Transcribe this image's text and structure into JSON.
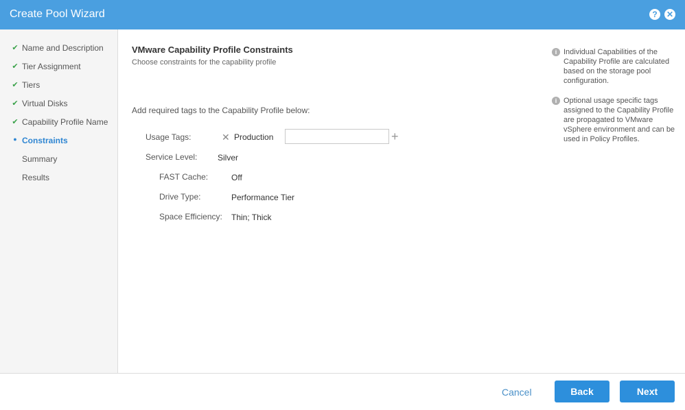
{
  "window": {
    "title": "Create Pool Wizard",
    "help_glyph": "?",
    "close_glyph": "✕"
  },
  "steps": [
    {
      "label": "Name and Description",
      "state": "done"
    },
    {
      "label": "Tier Assignment",
      "state": "done"
    },
    {
      "label": "Tiers",
      "state": "done"
    },
    {
      "label": "Virtual Disks",
      "state": "done"
    },
    {
      "label": "Capability Profile Name",
      "state": "done"
    },
    {
      "label": "Constraints",
      "state": "current"
    },
    {
      "label": "Summary",
      "state": "pending"
    },
    {
      "label": "Results",
      "state": "pending"
    }
  ],
  "main": {
    "title": "VMware Capability Profile Constraints",
    "subtitle": "Choose constraints for the capability profile",
    "intro": "Add required tags to the Capability Profile below:",
    "usage_tags_label": "Usage Tags:",
    "tag_value": "Production",
    "tag_remove_glyph": "✕",
    "tag_input_value": "",
    "add_glyph": "+",
    "service_level_label": "Service Level:",
    "service_level_value": "Silver",
    "fast_cache_label": "FAST Cache:",
    "fast_cache_value": "Off",
    "drive_type_label": "Drive Type:",
    "drive_type_value": "Performance Tier",
    "space_eff_label": "Space Efficiency:",
    "space_eff_value": "Thin; Thick"
  },
  "help": {
    "icon_glyph": "i",
    "note1": "Individual Capabilities of the Capability Profile are calculated based on the storage pool configuration.",
    "note2": "Optional usage specific tags assigned to the Capability Profile are propagated to VMware vSphere environment and can be used in Policy Profiles."
  },
  "footer": {
    "cancel_label": "Cancel",
    "back_label": "Back",
    "next_label": "Next"
  },
  "colors": {
    "titlebar": "#4a9fe0",
    "accent": "#2f86d2",
    "check": "#3aa24a",
    "button": "#2d8fdc"
  },
  "icons": {
    "done": "check-icon",
    "current": "bullet-icon"
  }
}
